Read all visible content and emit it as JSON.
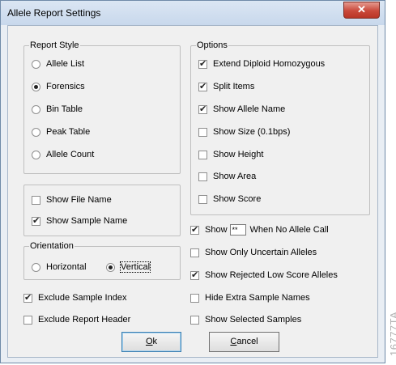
{
  "window": {
    "title": "Allele Report Settings",
    "close_glyph": "✕"
  },
  "report_style": {
    "legend": "Report Style",
    "options": [
      {
        "label": "Allele List",
        "selected": false
      },
      {
        "label": "Forensics",
        "selected": true
      },
      {
        "label": "Bin Table",
        "selected": false
      },
      {
        "label": "Peak Table",
        "selected": false
      },
      {
        "label": "Allele Count",
        "selected": false
      }
    ]
  },
  "file_sample": {
    "show_file_name": {
      "label": "Show File Name",
      "checked": false
    },
    "show_sample_name": {
      "label": "Show Sample Name",
      "checked": true
    }
  },
  "orientation": {
    "legend": "Orientation",
    "horizontal": {
      "label": "Horizontal",
      "selected": false
    },
    "vertical": {
      "label": "Vertical",
      "selected": true
    }
  },
  "exclude_sample_index": {
    "label": "Exclude Sample Index",
    "checked": true
  },
  "exclude_report_header": {
    "label": "Exclude Report Header",
    "checked": false
  },
  "options": {
    "legend": "Options",
    "items": [
      {
        "label": "Extend Diploid Homozygous",
        "checked": true
      },
      {
        "label": "Split Items",
        "checked": true
      },
      {
        "label": "Show Allele Name",
        "checked": true
      },
      {
        "label": "Show Size (0.1bps)",
        "checked": false
      },
      {
        "label": "Show Height",
        "checked": false
      },
      {
        "label": "Show Area",
        "checked": false
      },
      {
        "label": "Show Score",
        "checked": false
      }
    ]
  },
  "no_call": {
    "label_pre": "Show",
    "value": "**",
    "label_post": "When No Allele Call",
    "checked": true
  },
  "right_checks": [
    {
      "label": "Show Only Uncertain Alleles",
      "checked": false
    },
    {
      "label": "Show Rejected Low Score Alleles",
      "checked": true
    },
    {
      "label": "Hide Extra Sample Names",
      "checked": false
    },
    {
      "label": "Show Selected Samples",
      "checked": false
    }
  ],
  "buttons": {
    "ok": {
      "mnemonic": "O",
      "rest": "k"
    },
    "cancel": {
      "mnemonic": "C",
      "rest": "ancel"
    }
  },
  "watermark": "16777TA"
}
